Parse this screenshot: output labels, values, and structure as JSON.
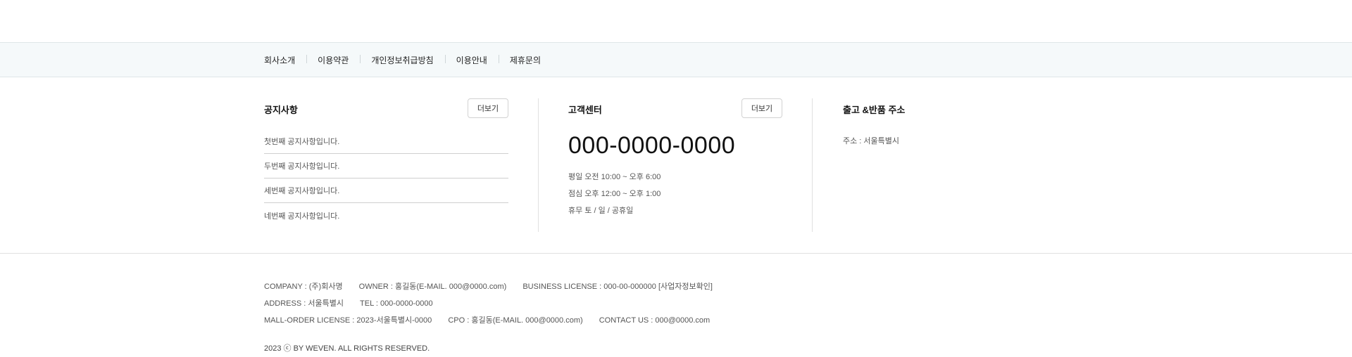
{
  "nav": {
    "links": [
      "회사소개",
      "이용약관",
      "개인정보취급방침",
      "이용안내",
      "제휴문의"
    ]
  },
  "notice": {
    "title": "공지사항",
    "more_label": "더보기",
    "items": [
      "첫번째 공지사항입니다.",
      "두번째 공지사항입니다.",
      "세번째 공지사항입니다.",
      "네번째 공지사항입니다."
    ]
  },
  "customer_center": {
    "title": "고객센터",
    "more_label": "더보기",
    "phone": "000-0000-0000",
    "hours": [
      "평일 오전 10:00 ~ 오후 6:00",
      "점심 오후 12:00 ~ 오후 1:00",
      "휴무 토 / 일 / 공휴일"
    ]
  },
  "return_address": {
    "title": "출고 &반품 주소",
    "address": "주소 : 서울특별시"
  },
  "company": {
    "company": "COMPANY : (주)회사명",
    "owner": "OWNER : 홍길동(E-MAIL. 000@0000.com)",
    "business_license": "BUSINESS LICENSE : 000-00-000000 [사업자정보확인]",
    "address": "ADDRESS : 서울특별시",
    "tel": "TEL : 000-0000-0000",
    "mall_order_license": "MALL-ORDER LICENSE : 2023-서울특별시-0000",
    "cpo": "CPO : 홍길동(E-MAIL. 000@0000.com)",
    "contact": "CONTACT US : 000@0000.com",
    "copyright": "2023 ⓒ BY WEVEN. ALL RIGHTS RESERVED."
  }
}
